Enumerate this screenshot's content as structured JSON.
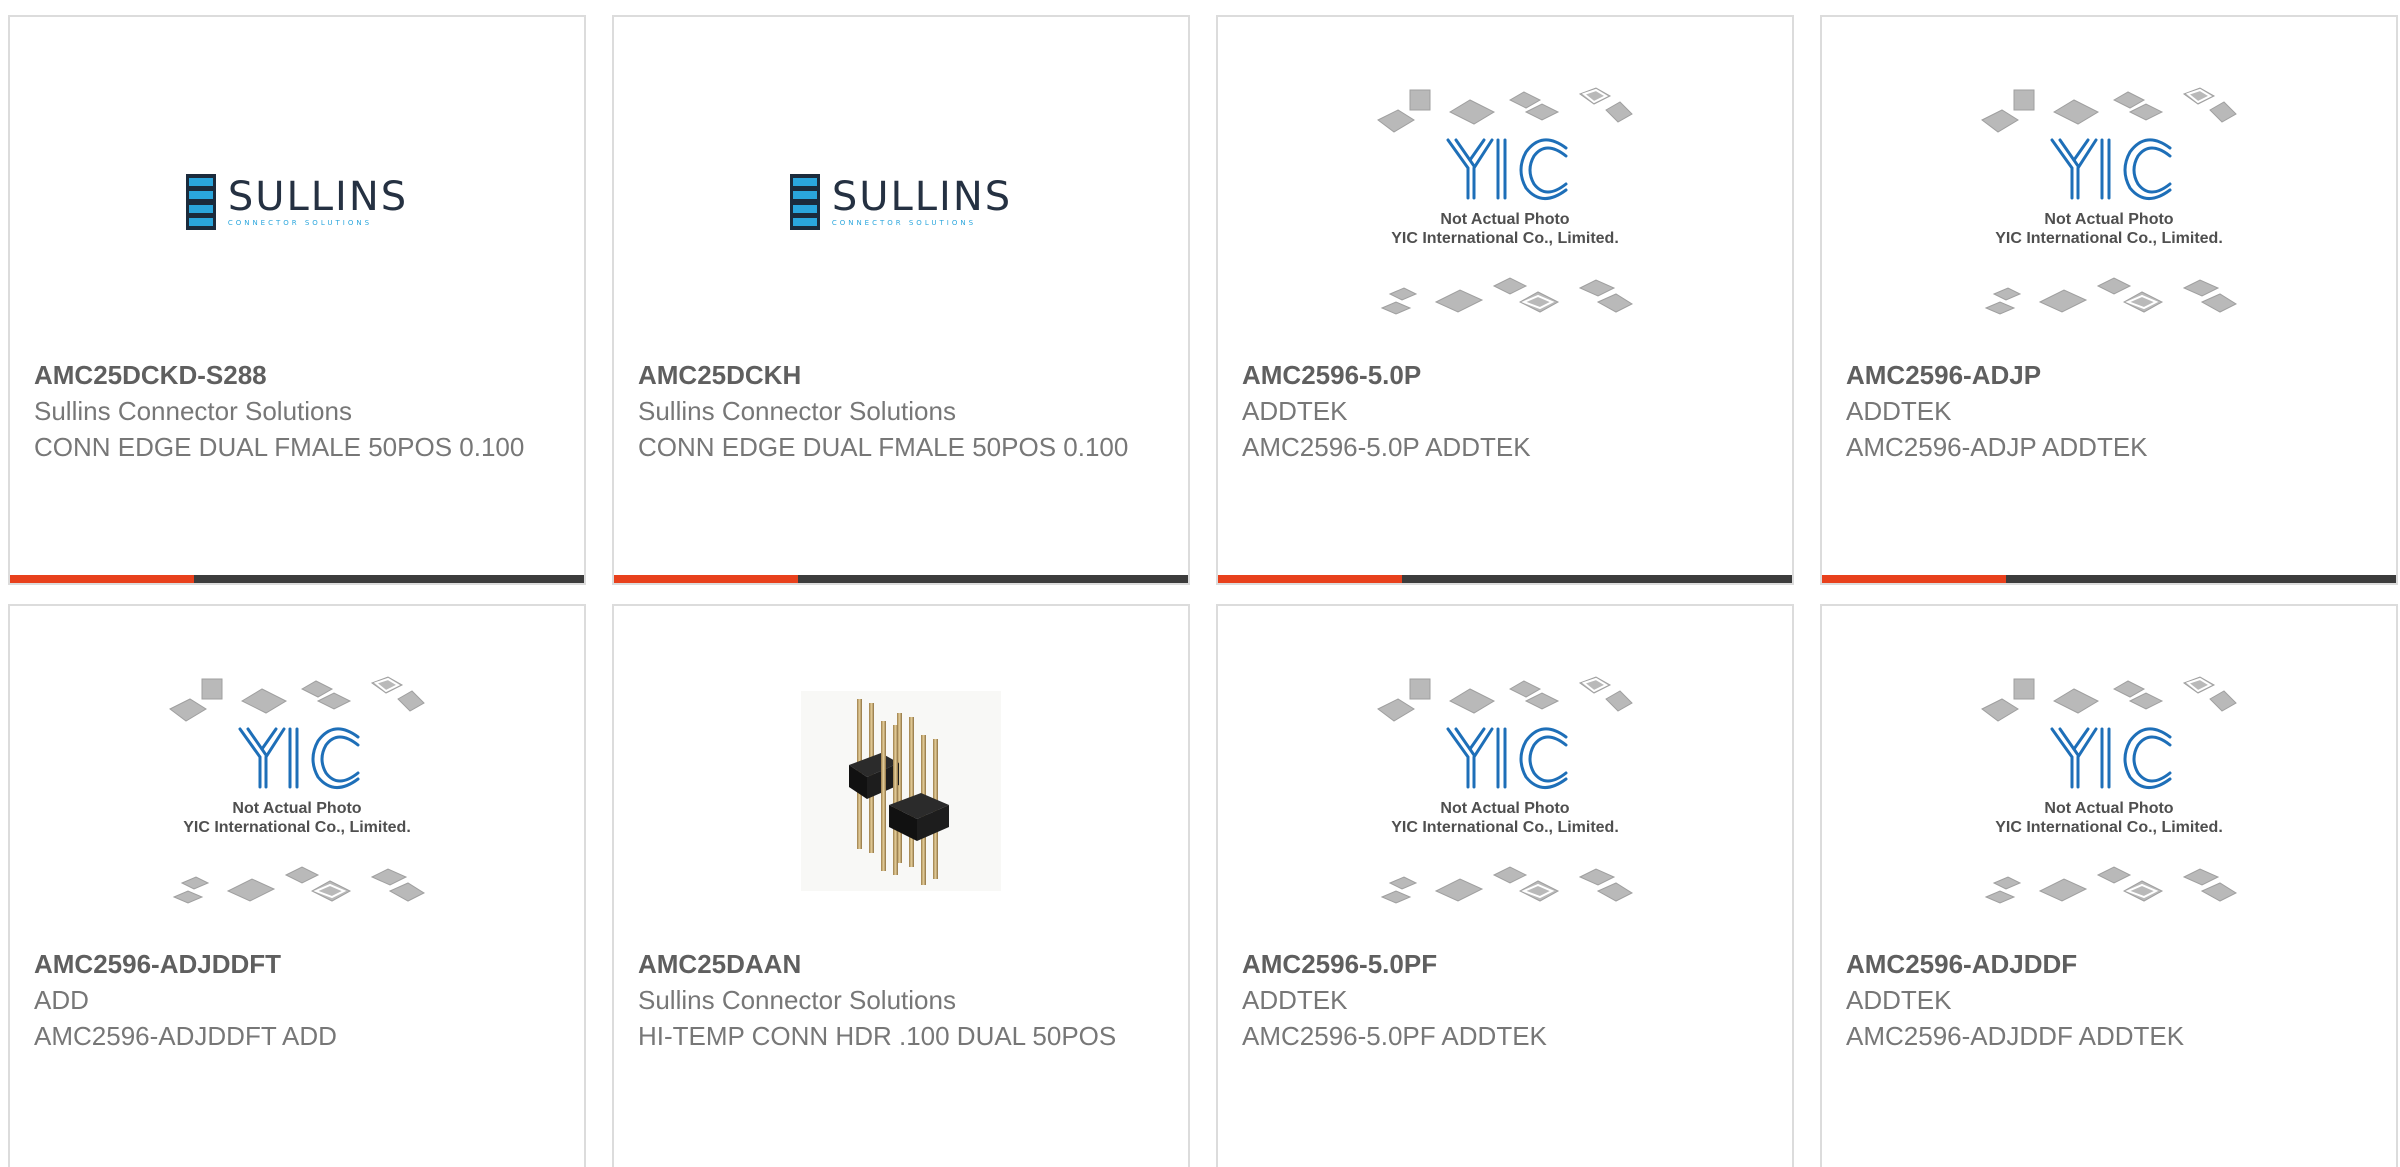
{
  "colors": {
    "accent": "#e8401c",
    "bar": "#3c3c3c",
    "border": "#dcdcdc",
    "yic_blue": "#1e6fb8",
    "sullins_blue": "#2aa6dd"
  },
  "logos": {
    "sullins": {
      "name": "SULLINS",
      "tagline": "CONNECTOR SOLUTIONS"
    },
    "yic": {
      "mark": "YIC",
      "line1": "Not Actual Photo",
      "line2": "YIC International Co., Limited."
    }
  },
  "products": [
    {
      "image": "sullins-logo",
      "part_number": "AMC25DCKD-S288",
      "manufacturer": "Sullins Connector Solutions",
      "description": "CONN EDGE DUAL FMALE 50POS 0.100"
    },
    {
      "image": "sullins-logo",
      "part_number": "AMC25DCKH",
      "manufacturer": "Sullins Connector Solutions",
      "description": "CONN EDGE DUAL FMALE 50POS 0.100"
    },
    {
      "image": "yic-placeholder",
      "part_number": "AMC2596-5.0P",
      "manufacturer": "ADDTEK",
      "description": "AMC2596-5.0P ADDTEK"
    },
    {
      "image": "yic-placeholder",
      "part_number": "AMC2596-ADJP",
      "manufacturer": "ADDTEK",
      "description": "AMC2596-ADJP ADDTEK"
    },
    {
      "image": "yic-placeholder",
      "part_number": "AMC2596-ADJDDFT",
      "manufacturer": "ADD",
      "description": "AMC2596-ADJDDFT ADD"
    },
    {
      "image": "pin-header-photo",
      "part_number": "AMC25DAAN",
      "manufacturer": "Sullins Connector Solutions",
      "description": "HI-TEMP CONN HDR .100 DUAL 50POS"
    },
    {
      "image": "yic-placeholder",
      "part_number": "AMC2596-5.0PF",
      "manufacturer": "ADDTEK",
      "description": "AMC2596-5.0PF ADDTEK"
    },
    {
      "image": "yic-placeholder",
      "part_number": "AMC2596-ADJDDF",
      "manufacturer": "ADDTEK",
      "description": "AMC2596-ADJDDF ADDTEK"
    }
  ]
}
